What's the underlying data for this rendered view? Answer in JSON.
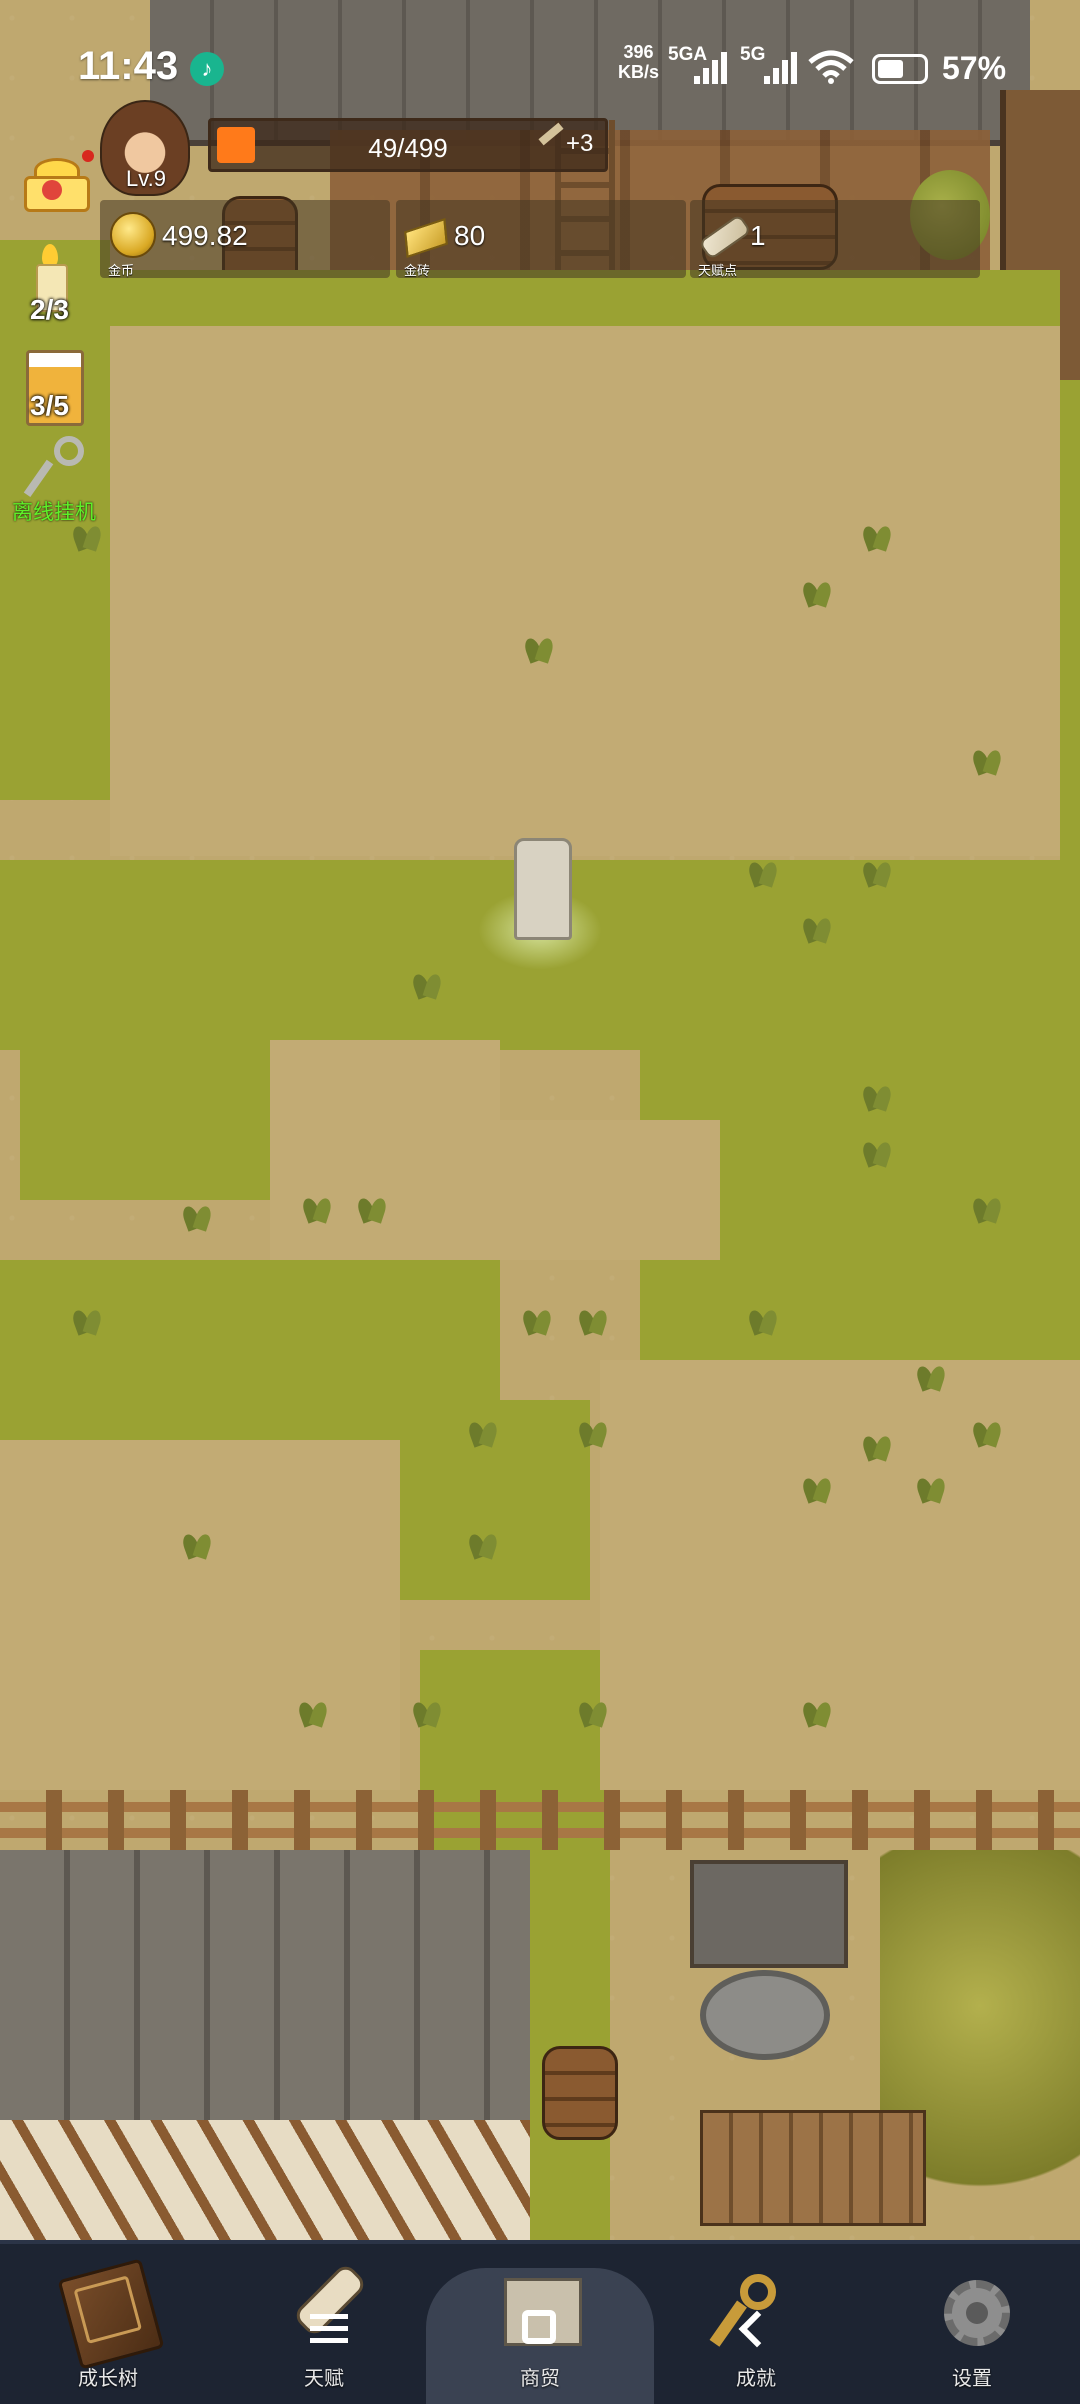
{
  "status_bar": {
    "time": "11:43",
    "net_speed_value": "396",
    "net_speed_unit": "KB/s",
    "network_1": "5GA",
    "network_2": "5G",
    "battery_percent": "57%",
    "battery_level": 0.57
  },
  "player": {
    "level": "Lv.9",
    "exp_text": "49/499",
    "exp_fraction": 0.098,
    "talent_bonus": "+3"
  },
  "resources": {
    "gold": {
      "value": "499.82",
      "caption": "金币",
      "icon": "coin-icon"
    },
    "gold_bar": {
      "value": "80",
      "caption": "金砖",
      "icon": "gold-bar-icon"
    },
    "talent_points": {
      "value": "1",
      "caption": "天赋点",
      "icon": "scroll-icon"
    }
  },
  "side_buttons": {
    "candle_count": "2/3",
    "beer_count": "3/5",
    "afk_label": "离线挂机"
  },
  "bottom_nav": [
    {
      "label": "成长树",
      "icon": "book-icon"
    },
    {
      "label": "天赋",
      "icon": "scroll-icon"
    },
    {
      "label": "商贸",
      "icon": "map-icon"
    },
    {
      "label": "成就",
      "icon": "key-icon"
    },
    {
      "label": "设置",
      "icon": "gear-icon"
    }
  ],
  "colors": {
    "exp_fill": "#ff7a1a",
    "afk_label": "#5ef028",
    "nav_bg": "#1d2432",
    "grass": "#9aa233",
    "dirt": "#c2ab74"
  }
}
